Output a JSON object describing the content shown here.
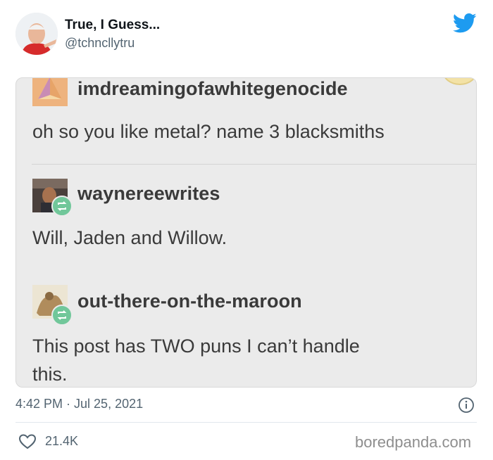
{
  "tweet": {
    "author_name": "True, I Guess...",
    "author_handle": "@tchncllytru",
    "timestamp": "4:42 PM · Jul 25, 2021",
    "likes": "21.4K"
  },
  "embedded_posts": [
    {
      "username": "imdreamingofawhitegenocide",
      "text": "oh so you like metal? name 3 blacksmiths"
    },
    {
      "username": "waynereewrites",
      "text": "Will, Jaden and Willow."
    },
    {
      "username": "out-there-on-the-maroon",
      "text_line1": "This post has TWO puns I can’t handle",
      "text_line2": "this."
    }
  ],
  "watermark": "boredpanda.com",
  "icons": {
    "brand": "twitter-bird-icon",
    "info": "info-icon",
    "like": "heart-icon",
    "reblog": "reblog-icon"
  },
  "colors": {
    "twitter_blue": "#1d9bf0",
    "embed_bg": "#ebebeb",
    "reblog_green": "#71c79a",
    "muted_text": "#536471"
  }
}
